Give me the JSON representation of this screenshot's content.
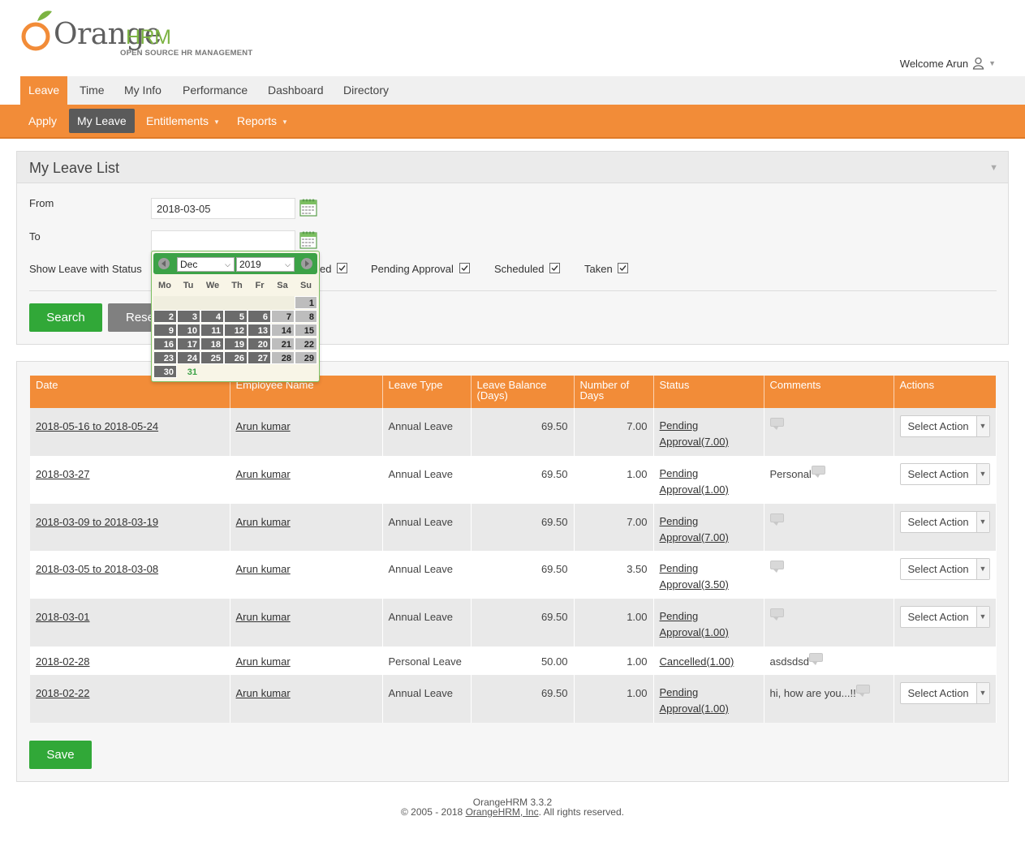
{
  "header": {
    "logo_word": "Orange",
    "logo_hrm": "HRM",
    "logo_tagline": "OPEN SOURCE HR MANAGEMENT",
    "welcome": "Welcome Arun"
  },
  "main_menu": [
    "Leave",
    "Time",
    "My Info",
    "Performance",
    "Dashboard",
    "Directory"
  ],
  "sub_menu": {
    "apply": "Apply",
    "my_leave": "My Leave",
    "entitlements": "Entitlements",
    "reports": "Reports"
  },
  "filter": {
    "title": "My Leave List",
    "from_label": "From",
    "from_value": "2018-03-05",
    "to_label": "To",
    "to_value": "",
    "status_label": "Show Leave with Status",
    "statuses": [
      {
        "label": "ed",
        "checked": true
      },
      {
        "label": "Pending Approval",
        "checked": true
      },
      {
        "label": "Scheduled",
        "checked": true
      },
      {
        "label": "Taken",
        "checked": true
      }
    ],
    "search_button": "Search",
    "reset_button": "Reset"
  },
  "datepicker": {
    "month": "Dec",
    "year": "2019",
    "weekdays": [
      "Mo",
      "Tu",
      "We",
      "Th",
      "Fr",
      "Sa",
      "Su"
    ],
    "days": [
      "1",
      "2",
      "3",
      "4",
      "5",
      "6",
      "7",
      "8",
      "9",
      "10",
      "11",
      "12",
      "13",
      "14",
      "15",
      "16",
      "17",
      "18",
      "19",
      "20",
      "21",
      "22",
      "23",
      "24",
      "25",
      "26",
      "27",
      "28",
      "29",
      "30",
      "31"
    ],
    "today": "31"
  },
  "table": {
    "headers": [
      "Date",
      "Employee Name",
      "Leave Type",
      "Leave Balance (Days)",
      "Number of Days",
      "Status",
      "Comments",
      "Actions"
    ],
    "rows": [
      {
        "date": "2018-05-16 to 2018-05-24",
        "employee": "Arun kumar",
        "type": "Annual Leave",
        "balance": "69.50",
        "days": "7.00",
        "status_1": "Pending",
        "status_2": "Approval(7.00)",
        "comment": "",
        "action": "Select Action"
      },
      {
        "date": "2018-03-27",
        "employee": "Arun kumar",
        "type": "Annual Leave",
        "balance": "69.50",
        "days": "1.00",
        "status_1": "Pending",
        "status_2": "Approval(1.00)",
        "comment": "Personal",
        "action": "Select Action"
      },
      {
        "date": "2018-03-09 to 2018-03-19",
        "employee": "Arun kumar",
        "type": "Annual Leave",
        "balance": "69.50",
        "days": "7.00",
        "status_1": "Pending",
        "status_2": "Approval(7.00)",
        "comment": "",
        "action": "Select Action"
      },
      {
        "date": "2018-03-05 to 2018-03-08",
        "employee": "Arun kumar",
        "type": "Annual Leave",
        "balance": "69.50",
        "days": "3.50",
        "status_1": "Pending",
        "status_2": "Approval(3.50)",
        "comment": "",
        "action": "Select Action"
      },
      {
        "date": "2018-03-01",
        "employee": "Arun kumar",
        "type": "Annual Leave",
        "balance": "69.50",
        "days": "1.00",
        "status_1": "Pending",
        "status_2": "Approval(1.00)",
        "comment": "",
        "action": "Select Action"
      },
      {
        "date": "2018-02-28",
        "employee": "Arun kumar",
        "type": "Personal Leave",
        "balance": "50.00",
        "days": "1.00",
        "status_1": "Cancelled(1.00)",
        "status_2": "",
        "comment": "asdsdsd",
        "action": ""
      },
      {
        "date": "2018-02-22",
        "employee": "Arun kumar",
        "type": "Annual Leave",
        "balance": "69.50",
        "days": "1.00",
        "status_1": "Pending",
        "status_2": "Approval(1.00)",
        "comment": "hi, how are you...!!",
        "action": "Select Action"
      }
    ],
    "save_button": "Save"
  },
  "footer": {
    "version": "OrangeHRM 3.3.2",
    "copyright_prefix": "© 2005 - 2018 ",
    "company_link": "OrangeHRM, Inc",
    "copyright_suffix": ". All rights reserved."
  },
  "colors": {
    "brand_orange": "#f28c38",
    "brand_green": "#31a838",
    "logo_green": "#7cb342"
  }
}
